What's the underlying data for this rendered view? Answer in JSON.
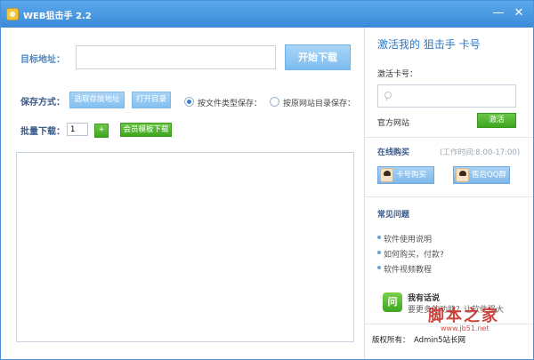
{
  "titlebar": {
    "title": "WEB狙击手 2.2",
    "minimize_glyph": "—",
    "close_glyph": "✕",
    "app_icon": "app-logo-icon"
  },
  "main": {
    "target_label": "目标地址：",
    "url_value": "",
    "start_button": "开始下载",
    "save_mode_label": "保存方式：",
    "choose_path_button": "选取存放地址",
    "open_dir_button": "打开目录",
    "save_by_type": "按文件类型保存：",
    "save_by_site": "按原网站目录保存：",
    "save_mode_selected": "type",
    "batch_label": "批量下载：",
    "batch_count": "1",
    "batch_add_glyph": "+",
    "member_template_button": "会员模板下载"
  },
  "activate": {
    "title": "激活我的 狙击手 卡号",
    "code_label": "激活卡号：",
    "code_value": "",
    "official_site": "官方网站",
    "activate_button": "激活"
  },
  "buy": {
    "title": "在线购买",
    "hours": "(工作时间:8:00-17:00)",
    "card_buy_button": "卡号购买",
    "qq_group_button": "售后QQ群"
  },
  "faq": {
    "title": "常见问题",
    "items": [
      "软件使用说明",
      "如何购买，付款?",
      "软件视频教程"
    ]
  },
  "feedback": {
    "icon_text": "问",
    "title": "我有话说",
    "text": "要更多的功能？让软件强大"
  },
  "footer": {
    "copyright": "版权所有：",
    "owner": "Admin5站长网"
  },
  "watermark": {
    "main": "脚本之家",
    "url": "www.jb51.net"
  },
  "colors": {
    "titlebar": "#3b8ad8",
    "accent": "#2a78c8",
    "green": "#3fa51f"
  }
}
